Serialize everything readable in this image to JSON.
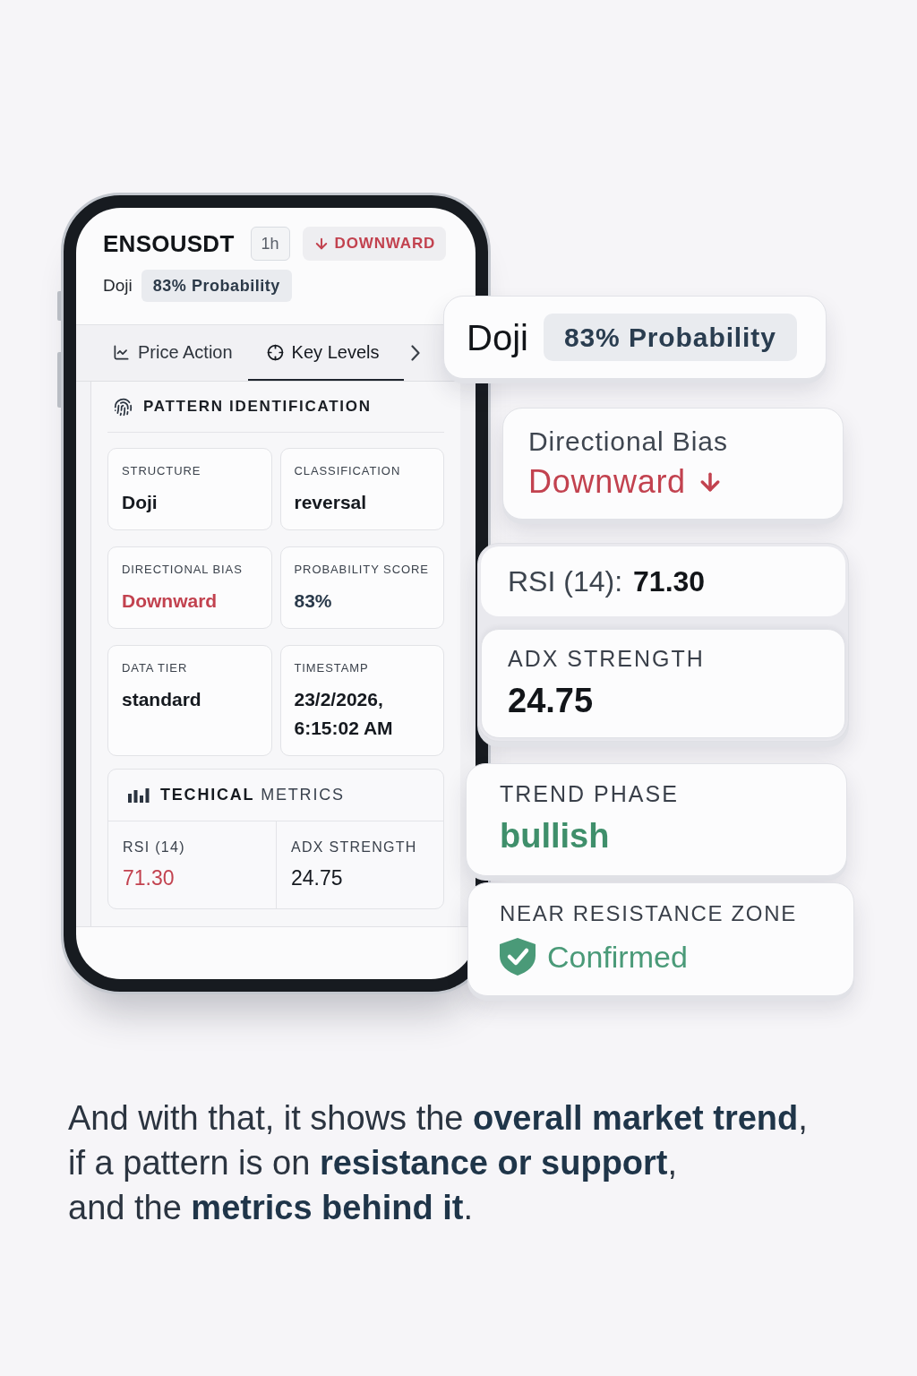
{
  "phone": {
    "header": {
      "symbol": "ENSOUSDT",
      "timeframe": "1h",
      "trend": {
        "label": "DOWNWARD",
        "kind": "down"
      },
      "pattern": "Doji",
      "probability": "83% Probability"
    },
    "tabs": [
      {
        "label": "Price Action",
        "selected": false
      },
      {
        "label": "Key Levels",
        "selected": true
      }
    ],
    "section": {
      "title": "PATTERN IDENTIFICATION",
      "fields": [
        {
          "label": "STRUCTURE",
          "value": "Doji",
          "color": "#15191f"
        },
        {
          "label": "CLASSIFICATION",
          "value": "reversal",
          "color": "#15191f"
        },
        {
          "label": "DIRECTIONAL BIAS",
          "value": "Downward",
          "color": "#c2424f"
        },
        {
          "label": "PROBABILITY SCORE",
          "value": "83%",
          "color": "#2a3a4b"
        },
        {
          "label": "DATA TIER",
          "value": "standard",
          "color": "#15191f"
        },
        {
          "label": "TIMESTAMP",
          "value": "23/2/2026, 6:15:02 AM",
          "color": "#15191f"
        }
      ]
    },
    "metrics": {
      "title": "**TECHICAL** METRICS",
      "items": [
        {
          "label": "RSI (14)",
          "value": "71.30",
          "color": "#c2424f"
        },
        {
          "label": "ADX STRENGTH",
          "value": "24.75",
          "color": "#15191f"
        }
      ]
    }
  },
  "callouts": {
    "pattern": {
      "name": "Doji",
      "probability": "83% Probability"
    },
    "bias": {
      "label": "Directional Bias",
      "value": "Downward",
      "kind": "down"
    },
    "rsi": {
      "label": "RSI (14):",
      "value": "71.30"
    },
    "adx": {
      "label": "ADX STRENGTH",
      "value": "24.75"
    },
    "trend_phase": {
      "label": "TREND PHASE",
      "value": "bullish",
      "color": "#3f8f6b"
    },
    "resistance": {
      "label": "NEAR RESISTANCE ZONE",
      "value": "Confirmed",
      "confirmed": true
    }
  },
  "caption": [
    "And with that, it shows the **overall market trend**,",
    "if a pattern is on **resistance or support**,",
    "and the **metrics behind it**."
  ]
}
